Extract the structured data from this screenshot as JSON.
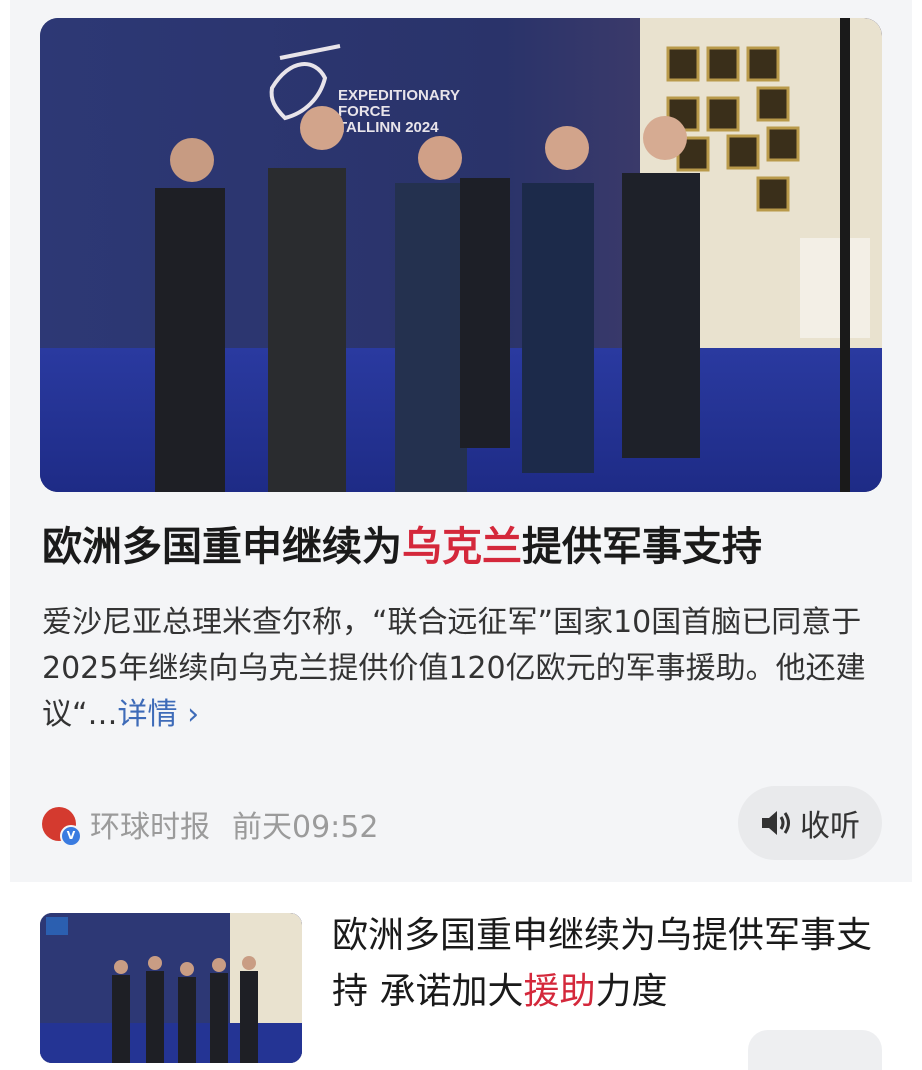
{
  "article": {
    "image": {
      "sign_line1": "EXPEDITIONARY",
      "sign_line2": "FORCE",
      "sign_line3": "TALLINN 2024"
    },
    "headline_pre": "欧洲多国重申继续为",
    "headline_highlight": "乌克兰",
    "headline_post": "提供军事支持",
    "summary": "爱沙尼亚总理米查尔称，“联合远征军”国家10国首脑已同意于2025年继续向乌克兰提供价值120亿欧元的军事援助。他还建议“…",
    "more_label": "详情 ›",
    "source_name": "环球时报",
    "time": "前天09:52",
    "listen_label": "收听"
  },
  "next_article": {
    "title_pre": "欧洲多国重申继续为乌提供军事支持 承诺加大",
    "title_highlight": "援助",
    "title_post": "力度"
  },
  "colors": {
    "highlight": "#d4283b",
    "link": "#3e6bb8",
    "muted": "#9b9b9b"
  }
}
